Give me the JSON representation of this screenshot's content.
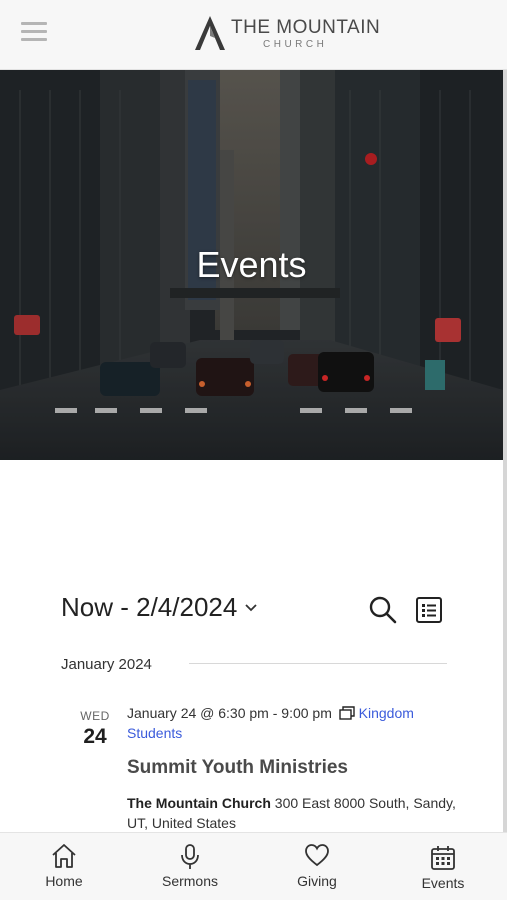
{
  "header": {
    "logo_title": "THE MOUNTAIN",
    "logo_subtitle": "CHURCH"
  },
  "hero": {
    "title": "Events"
  },
  "toolbar": {
    "range_label": "Now - 2/4/2024"
  },
  "month_separator": "January 2024",
  "events": [
    {
      "day_of_week": "WED",
      "day": "24",
      "datetime": "January 24 @ 6:30 pm - 9:00 pm",
      "series": "Kingdom Students",
      "title": "Summit Youth Ministries",
      "venue_name": "The Mountain Church",
      "venue_address": "300 East 8000 South, Sandy, UT, United States"
    }
  ],
  "bottom_nav": {
    "items": [
      {
        "label": "Home",
        "icon": "home-icon"
      },
      {
        "label": "Sermons",
        "icon": "microphone-icon"
      },
      {
        "label": "Giving",
        "icon": "heart-icon"
      },
      {
        "label": "Events",
        "icon": "calendar-icon"
      }
    ]
  },
  "colors": {
    "link": "#3b5bdb",
    "header_bg": "#f7f7f7",
    "text": "#222222"
  }
}
